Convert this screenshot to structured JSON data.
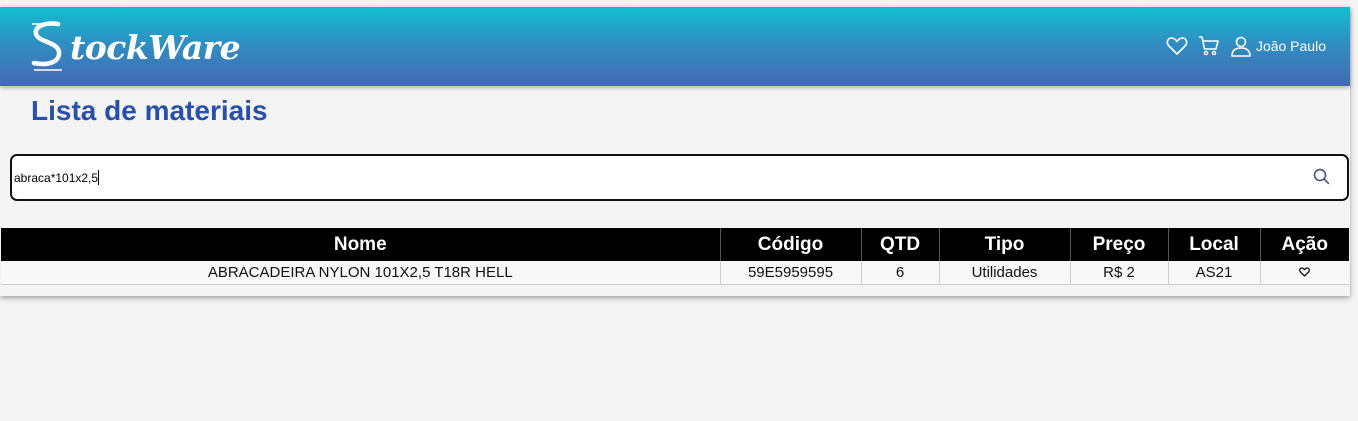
{
  "header": {
    "logo_text": "tockWare",
    "logo_mark": "S",
    "user_name": "João Paulo",
    "icons": [
      "heart-icon",
      "cart-icon",
      "user-icon"
    ],
    "colors": {
      "gradient_top": "#12bfce",
      "gradient_bottom": "#4669b4"
    }
  },
  "page": {
    "title": "Lista de materiais",
    "title_color": "#2850a8"
  },
  "search": {
    "value": "abraca*101x2,5",
    "icon": "search-icon"
  },
  "table": {
    "columns": [
      "Nome",
      "Código",
      "QTD",
      "Tipo",
      "Preço",
      "Local",
      "Ação"
    ],
    "rows": [
      {
        "nome": "ABRACADEIRA NYLON 101X2,5 T18R HELL",
        "codigo": "59E5959595",
        "qtd": "6",
        "tipo": "Utilidades",
        "preco": "R$ 2",
        "local": "AS21",
        "acao": "heart-icon"
      }
    ]
  }
}
